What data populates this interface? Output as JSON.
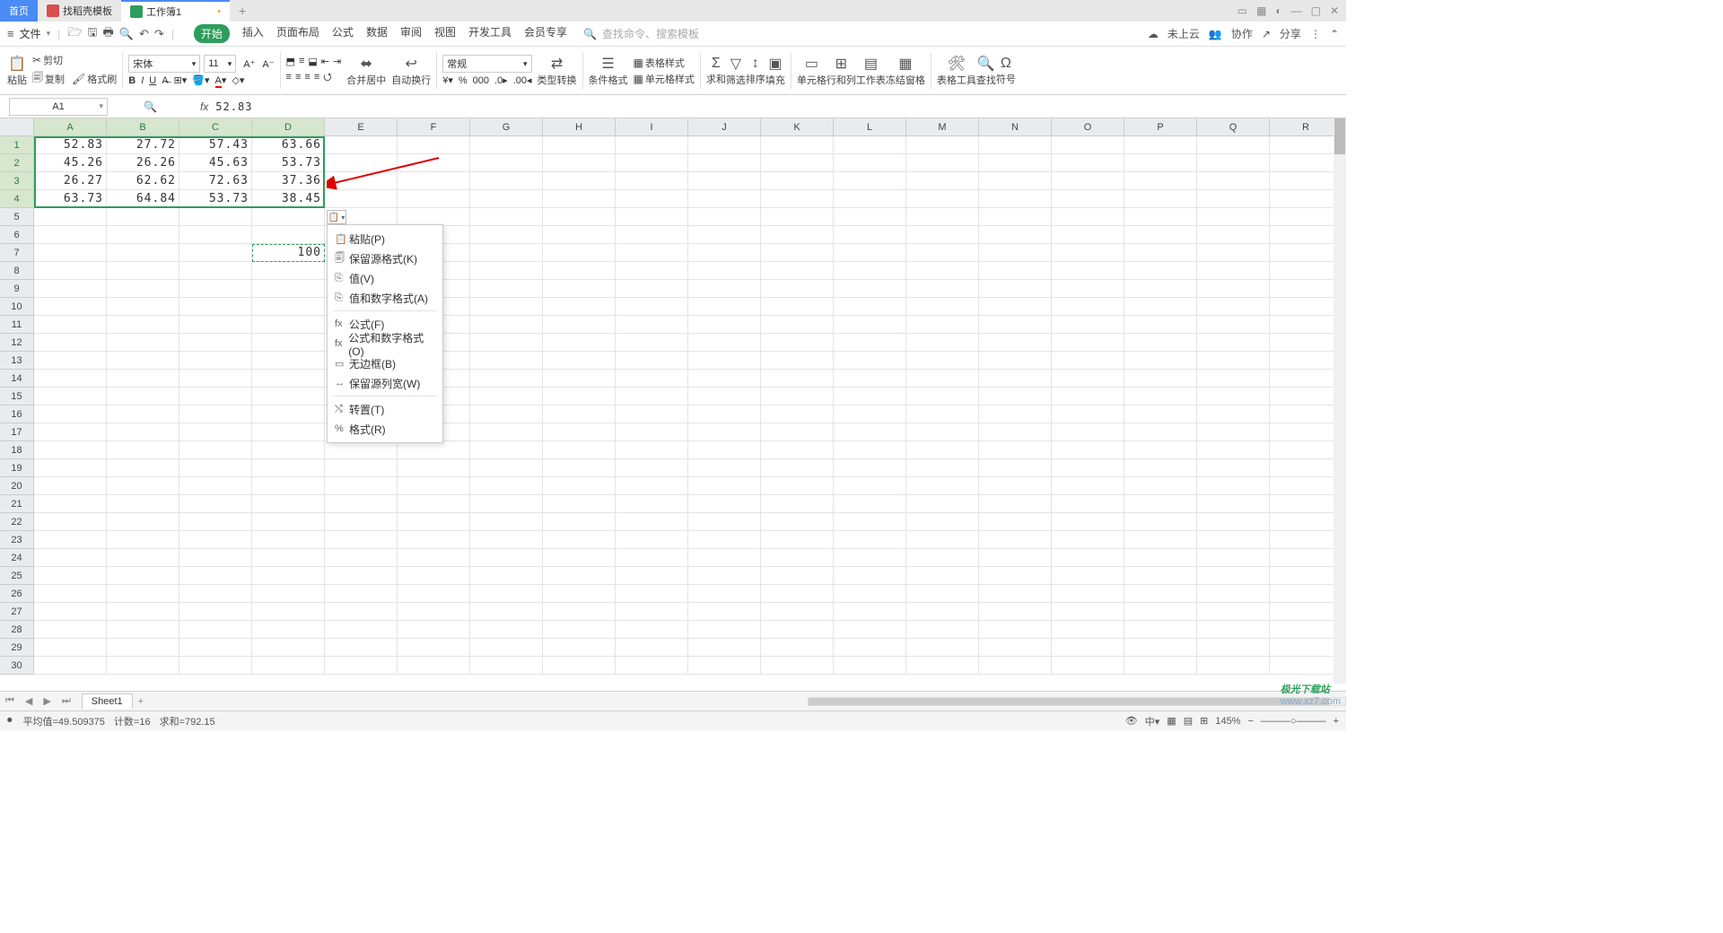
{
  "titlebar": {
    "home": "首页",
    "tpl": "找稻壳模板",
    "wb": "工作簿1",
    "add": "+"
  },
  "menubar": {
    "file": "文件",
    "tabs": [
      "开始",
      "插入",
      "页面布局",
      "公式",
      "数据",
      "审阅",
      "视图",
      "开发工具",
      "会员专享"
    ],
    "active_index": 0,
    "search1": "查找命令、搜索模板",
    "cloud": "未上云",
    "coop": "协作",
    "share": "分享"
  },
  "ribbon": {
    "paste": "粘贴",
    "cut": "剪切",
    "copy": "复制",
    "fmtpaint": "格式刷",
    "font": "宋体",
    "size": "11",
    "merge": "合并居中",
    "wrap": "自动换行",
    "numfmt": "常规",
    "typeconv": "类型转换",
    "condfmt": "条件格式",
    "tablestyle": "表格样式",
    "cellstyle": "单元格样式",
    "sum": "求和",
    "filter": "筛选",
    "sort": "排序",
    "fill": "填充",
    "cell": "单元格",
    "rowcol": "行和列",
    "sheet": "工作表",
    "freeze": "冻结窗格",
    "tools": "表格工具",
    "find": "查找",
    "symbol": "符号"
  },
  "fbar": {
    "name": "A1",
    "fx": "52.83"
  },
  "columns": [
    "A",
    "B",
    "C",
    "D",
    "E",
    "F",
    "G",
    "H",
    "I",
    "J",
    "K",
    "L",
    "M",
    "N",
    "O",
    "P",
    "Q",
    "R"
  ],
  "selected_cols": [
    0,
    1,
    2,
    3
  ],
  "selected_rows": [
    0,
    1,
    2,
    3
  ],
  "row_count": 30,
  "cells": {
    "r0": [
      "52.83",
      "27.72",
      "57.43",
      "63.66"
    ],
    "r1": [
      "45.26",
      "26.26",
      "45.63",
      "53.73"
    ],
    "r2": [
      "26.27",
      "62.62",
      "72.63",
      "37.36"
    ],
    "r3": [
      "63.73",
      "64.84",
      "53.73",
      "38.45"
    ],
    "r6c3": "100"
  },
  "paste_menu": {
    "items": [
      {
        "ico": "📋",
        "label": "粘贴(P)"
      },
      {
        "ico": "🗐",
        "label": "保留源格式(K)"
      },
      {
        "ico": "⎘",
        "label": "值(V)"
      },
      {
        "ico": "⎘",
        "label": "值和数字格式(A)"
      }
    ],
    "items2": [
      {
        "ico": "fx",
        "label": "公式(F)"
      },
      {
        "ico": "fx",
        "label": "公式和数字格式(O)"
      },
      {
        "ico": "▭",
        "label": "无边框(B)"
      },
      {
        "ico": "↔",
        "label": "保留源列宽(W)"
      }
    ],
    "items3": [
      {
        "ico": "⤭",
        "label": "转置(T)"
      },
      {
        "ico": "%",
        "label": "格式(R)"
      }
    ]
  },
  "sheetbar": {
    "sheet": "Sheet1"
  },
  "statusbar": {
    "avg": "平均值=49.509375",
    "cnt": "计数=16",
    "sum": "求和=792.15",
    "zoom": "145%"
  },
  "watermark": {
    "brand": "极光下载站",
    "url": "www.xz7.com"
  }
}
